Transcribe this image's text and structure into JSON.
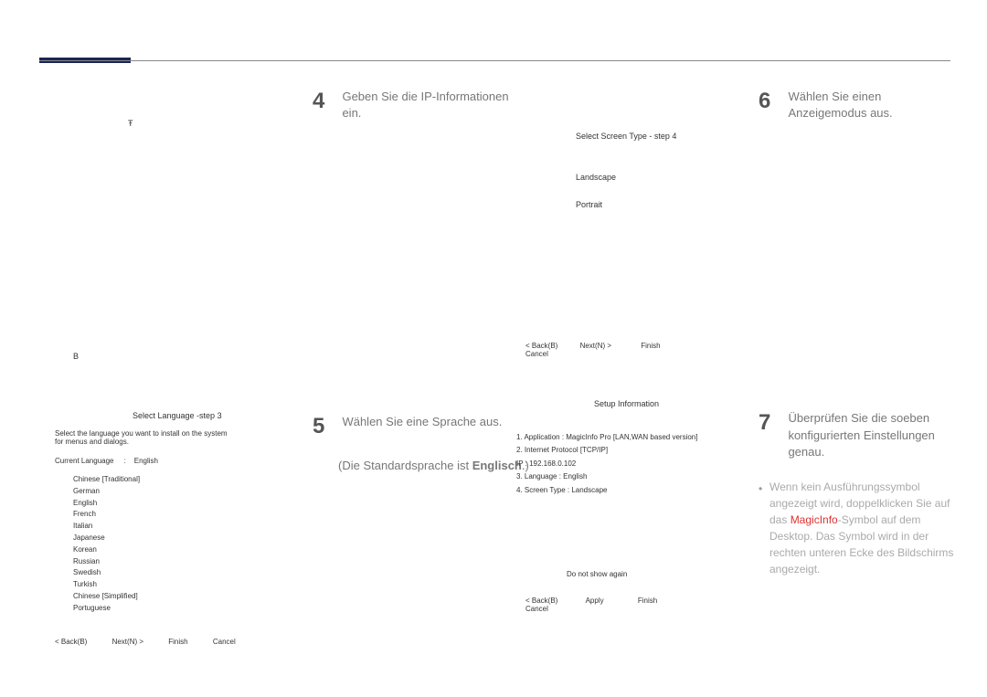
{
  "col1": {
    "t_char": "Ŧ",
    "b_char": "B",
    "lang_title": "Select Language -step 3",
    "lang_desc": "Select the language you want to install on the system for menus and dialogs.",
    "current_lang_label": "Current Language",
    "current_lang_sep": ":",
    "current_lang_val": "English",
    "languages": [
      "Chinese [Traditional]",
      "German",
      "English",
      "French",
      "Italian",
      "Japanese",
      "Korean",
      "Russian",
      "Swedish",
      "Turkish",
      "Chinese [Simplified]",
      "Portuguese"
    ],
    "btn_back": "< Back(B)",
    "btn_next": "Next(N) >",
    "btn_finish": "Finish",
    "btn_cancel": "Cancel"
  },
  "col2": {
    "step_num": "4",
    "step_text": "Geben Sie die IP-Informationen ein.",
    "step_num2": "5",
    "step_text2": "Wählen Sie eine Sprache aus.",
    "step_sub2_prefix": "(Die Standardsprache ist ",
    "step_sub2_bold": "Englisch",
    "step_sub2_suffix": ".)"
  },
  "col3": {
    "screen_title": "Select Screen Type - step 4",
    "opt_landscape": "Landscape",
    "opt_portrait": "Portrait",
    "btn_back": "< Back(B)",
    "btn_next": "Next(N) >",
    "btn_finish": "Finish",
    "btn_cancel": "Cancel",
    "setup_title": "Setup Information",
    "info_rows": [
      "1. Application :    MagicInfo Pro [LAN,WAN based version]",
      "2. Internet Protocol [TCP/IP]",
      "       IP :      192.168.0.102",
      "3. Language :    English",
      "4. Screen Type :    Landscape"
    ],
    "chk_label": "Do not show again",
    "btn2_back": "< Back(B)",
    "btn2_apply": "Apply",
    "btn2_finish": "Finish",
    "btn2_cancel": "Cancel"
  },
  "col4": {
    "step_num": "6",
    "step_text": "Wählen Sie einen Anzeigemodus aus.",
    "step_num2": "7",
    "step_text2a": "Überprüfen Sie die soeben",
    "step_text2b": "konfigurierten Einstellungen genau.",
    "bullet": "•",
    "note1": "Wenn kein Ausführungssymbol angezeigt wird, doppelklicken Sie auf das ",
    "note_magic": "MagicInfo",
    "note2": "-Symbol auf dem Desktop. Das Symbol wird in der rechten unteren Ecke des Bildschirms angezeigt."
  }
}
